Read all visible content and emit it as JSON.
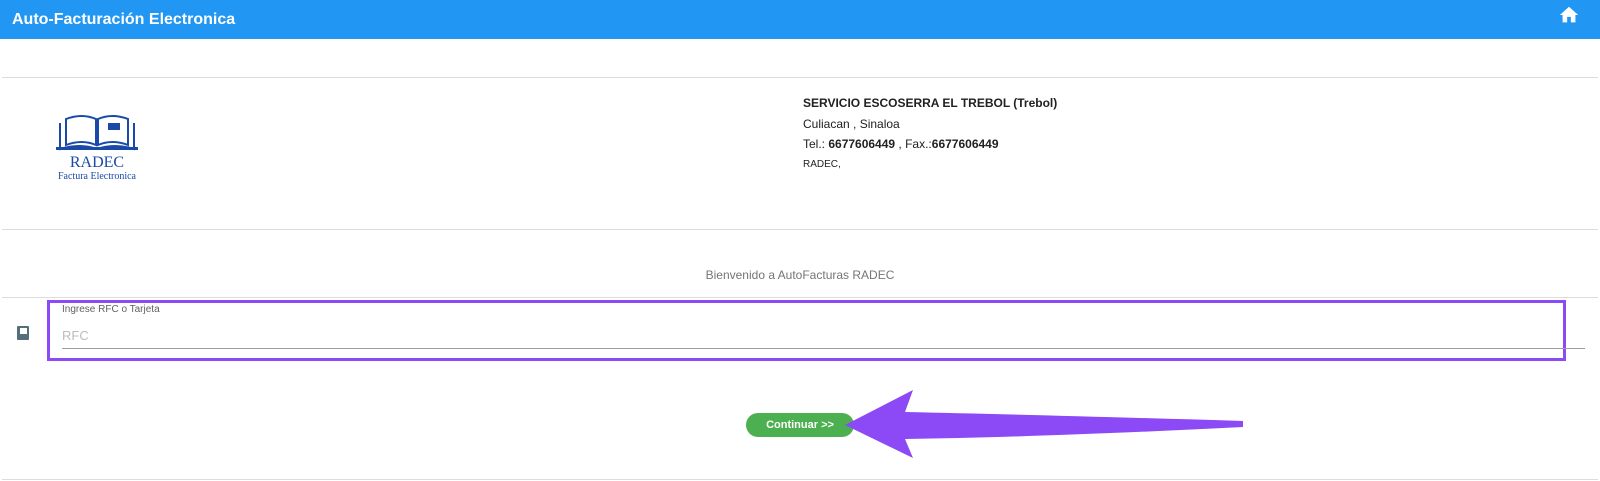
{
  "header": {
    "title": "Auto-Facturación Electronica",
    "home_icon": "home-icon",
    "bg_color": "#2196f3"
  },
  "logo": {
    "name": "RADEC",
    "subtitle": "Factura Electronica",
    "color": "#1a4aa8"
  },
  "company": {
    "name": "SERVICIO ESCOSERRA EL TREBOL (Trebol)",
    "location": "Culiacan , Sinaloa",
    "tel_label": "Tel.: ",
    "tel": "6677606449",
    "fax_label": " , Fax.:",
    "fax": "6677606449",
    "footer": "RADEC,"
  },
  "welcome": "Bienvenido a AutoFacturas RADEC",
  "rfc_field": {
    "icon": "card-icon",
    "label": "Ingrese RFC o Tarjeta",
    "placeholder": "RFC",
    "value": ""
  },
  "continue_button": {
    "label": "Continuar >>",
    "color": "#4caf50"
  },
  "annotation": {
    "highlight_color": "#8c4af6",
    "arrow_color": "#8c4af6"
  }
}
